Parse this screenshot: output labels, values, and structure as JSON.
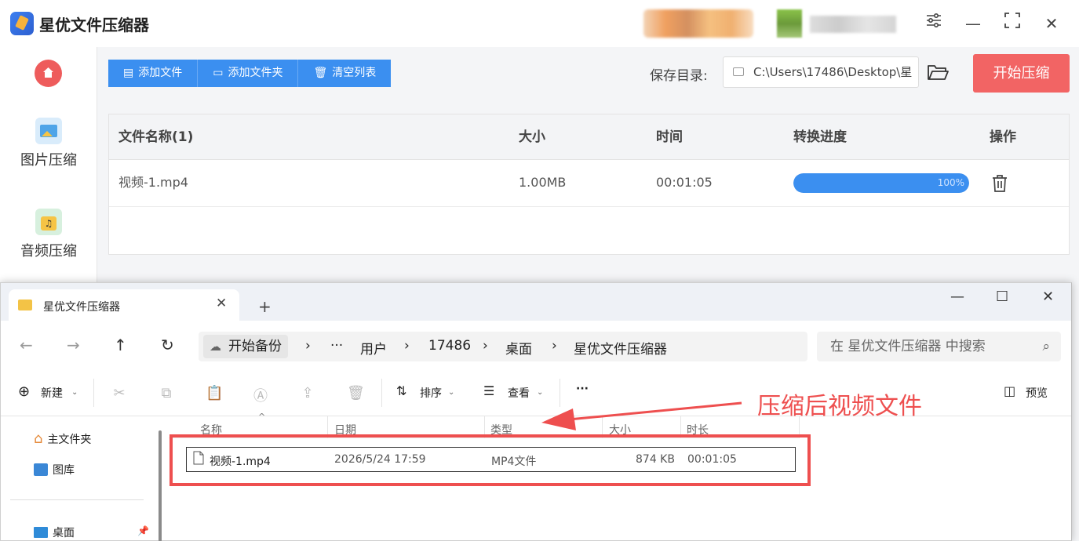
{
  "app": {
    "title": "星优文件压缩器",
    "sidebar": {
      "items": [
        {
          "label": "图片压缩"
        },
        {
          "label": "音频压缩"
        }
      ]
    },
    "toolbar": {
      "add_file": "添加文件",
      "add_folder": "添加文件夹",
      "clear_list": "清空列表"
    },
    "save": {
      "label": "保存目录:",
      "path": "C:\\Users\\17486\\Desktop\\星"
    },
    "start_button": "开始压缩",
    "table": {
      "headers": {
        "name": "文件名称(1)",
        "size": "大小",
        "time": "时间",
        "progress": "转换进度",
        "action": "操作"
      },
      "rows": [
        {
          "name": "视频-1.mp4",
          "size": "1.00MB",
          "time": "00:01:05",
          "progress_value": 1.0,
          "progress_text": "100%"
        }
      ]
    },
    "colors": {
      "accent": "#3b8ff0",
      "start": "#f26464"
    }
  },
  "explorer": {
    "tab_title": "星优文件压缩器",
    "address": {
      "backup": "开始备份",
      "ellipsis": "···",
      "crumbs": [
        "用户",
        "17486",
        "桌面",
        "星优文件压缩器"
      ]
    },
    "search_placeholder": "在 星优文件压缩器 中搜索",
    "toolbar": {
      "new": "新建",
      "sort": "排序",
      "view": "查看",
      "more": "···",
      "preview": "预览"
    },
    "nav": {
      "home": "主文件夹",
      "gallery": "图库",
      "desktop": "桌面"
    },
    "columns": {
      "name": "名称",
      "date": "日期",
      "type": "类型",
      "size": "大小",
      "duration": "时长"
    },
    "files": [
      {
        "name": "视频-1.mp4",
        "date": "2026/5/24 17:59",
        "type": "MP4文件",
        "size": "874 KB",
        "duration": "00:01:05"
      }
    ]
  },
  "annotation": {
    "text": "压缩后视频文件",
    "color": "#ee4f4f"
  }
}
